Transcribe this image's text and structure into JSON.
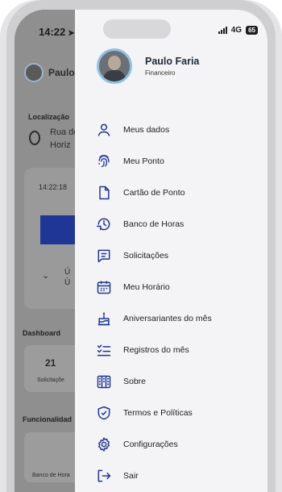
{
  "status": {
    "time": "14:22",
    "network": "4G",
    "battery": "65"
  },
  "background": {
    "user_name": "Paulo",
    "location_label": "Localização",
    "location_line1": "Rua de",
    "location_line2": "Horiz",
    "clock_time": "14:22:18",
    "last_line1": "Ú",
    "last_line2": "Ú",
    "dashboard_label": "Dashboard",
    "requests_count": "21",
    "requests_label": "Solicitaçõe",
    "features_label": "Funcionalidad",
    "hours_bank_label": "Banco de Hora"
  },
  "profile": {
    "name": "Paulo Faria",
    "role": "Financeiro"
  },
  "menu": {
    "items": [
      {
        "label": "Meus dados",
        "icon": "person-icon"
      },
      {
        "label": "Meu Ponto",
        "icon": "fingerprint-icon"
      },
      {
        "label": "Cartão de Ponto",
        "icon": "document-icon"
      },
      {
        "label": "Banco de Horas",
        "icon": "clock-history-icon"
      },
      {
        "label": "Solicitações",
        "icon": "message-icon"
      },
      {
        "label": "Meu Horário",
        "icon": "calendar-icon"
      },
      {
        "label": "Aniversariantes do mês",
        "icon": "cake-icon"
      },
      {
        "label": "Registros do mês",
        "icon": "checklist-icon"
      },
      {
        "label": "Sobre",
        "icon": "building-icon"
      },
      {
        "label": "Termos e Políticas",
        "icon": "shield-check-icon"
      },
      {
        "label": "Configurações",
        "icon": "gear-icon"
      },
      {
        "label": "Sair",
        "icon": "logout-icon"
      }
    ]
  },
  "colors": {
    "accent": "#1f3696",
    "drawer_bg": "#f4f4f6",
    "icon": "#1f3696"
  }
}
